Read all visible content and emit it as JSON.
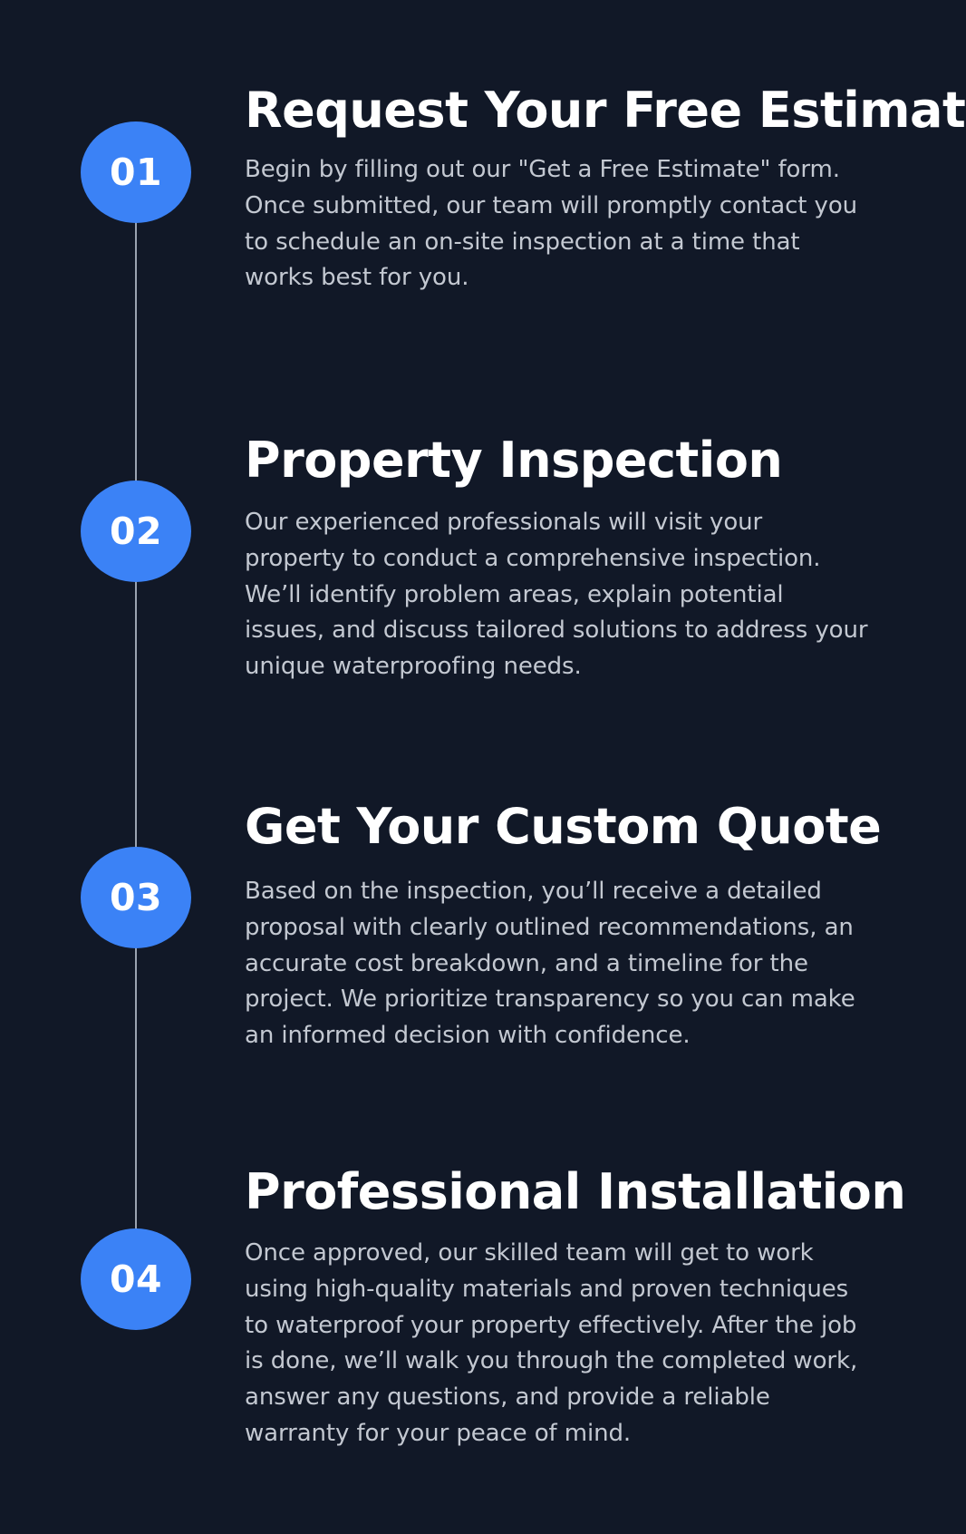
{
  "steps": [
    {
      "number": "01",
      "title": "Request Your Free Estimate",
      "description": "Begin by filling out our \"Get a Free Estimate\" form.\nOnce submitted, our team will promptly contact you\nto schedule an on-site inspection at a time that\nworks best for you."
    },
    {
      "number": "02",
      "title": "Property Inspection",
      "description": "Our experienced professionals will visit your\nproperty to conduct a comprehensive inspection.\nWe’ll identify problem areas, explain potential\nissues, and discuss tailored solutions to address your\nunique waterproofing needs."
    },
    {
      "number": "03",
      "title": "Get Your Custom Quote",
      "description": "Based on the inspection, you’ll receive a detailed\nproposal with clearly outlined recommendations, an\naccurate cost breakdown, and a timeline for the\nproject. We prioritize transparency so you can make\nan informed decision with confidence."
    },
    {
      "number": "04",
      "title": "Professional Installation",
      "description": "Once approved, our skilled team will get to work\nusing high-quality materials and proven techniques\nto waterproof your property effectively. After the job\nis done, we’ll walk you through the completed work,\nanswer any questions, and provide a reliable\nwarranty for your peace of mind."
    }
  ],
  "colors": {
    "background": "#111827",
    "accent": "#3b82f6",
    "title": "#ffffff",
    "body_text": "#c3c8d1",
    "line": "#9aa3b0"
  }
}
